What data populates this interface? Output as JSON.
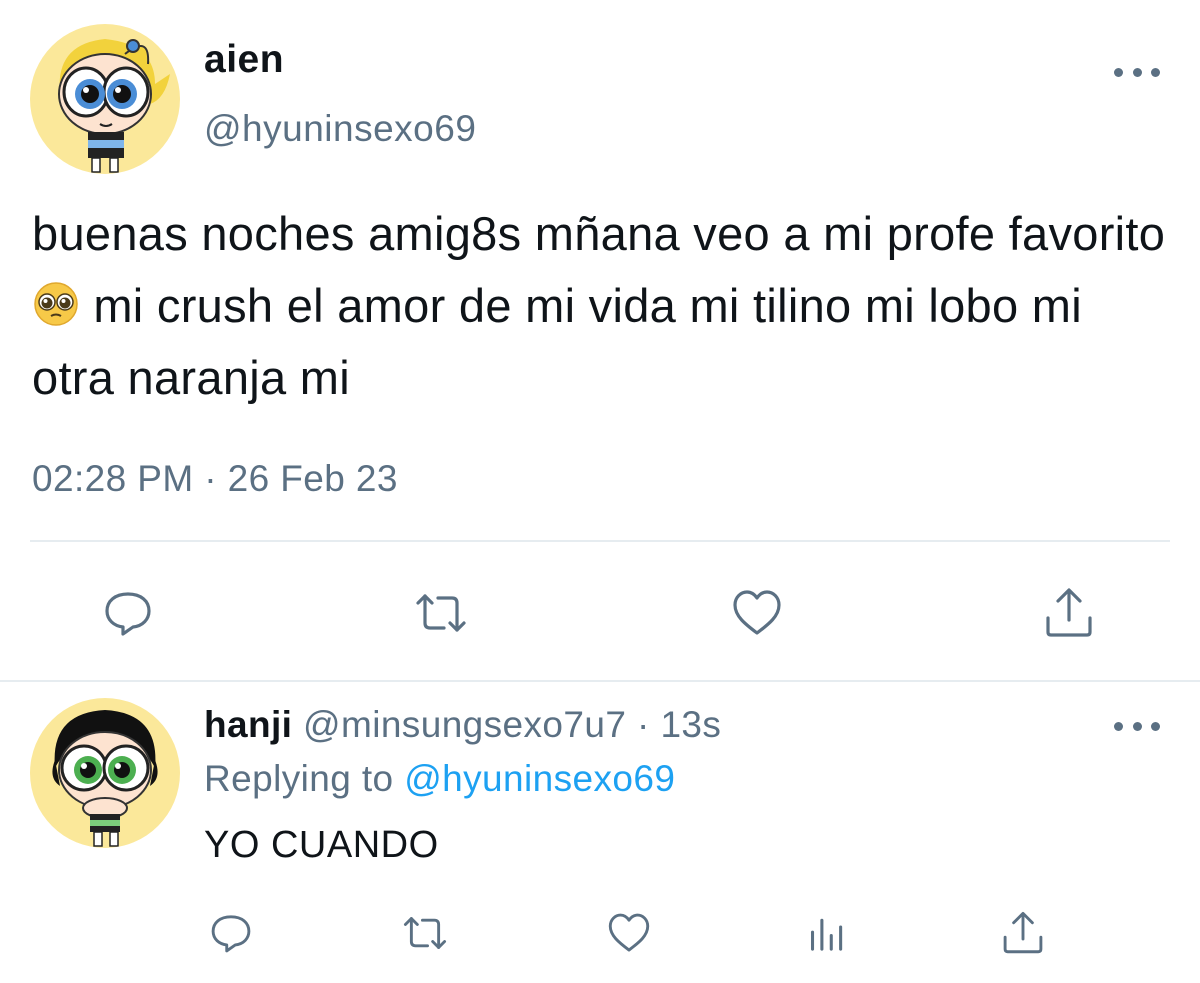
{
  "tweet": {
    "author_name": "aien",
    "author_handle": "@hyuninsexo69",
    "text_before_emoji": "buenas noches amig8s mñana veo a mi profe favorito",
    "emoji": "pleading-face-emoji",
    "text_after_emoji": " mi crush el amor de mi vida mi tilino mi lobo mi otra naranja mi",
    "timestamp": "02:28 PM · 26 Feb 23",
    "avatar": "bubbles-avatar",
    "actions": [
      "reply-icon",
      "retweet-icon",
      "like-icon",
      "share-icon"
    ]
  },
  "reply": {
    "author_name": "hanji",
    "author_handle": "@minsungsexo7u7",
    "separator": "·",
    "time_ago": "13s",
    "replying_label": "Replying to",
    "replying_handle": "@hyuninsexo69",
    "text": "YO CUANDO",
    "avatar": "buttercup-avatar",
    "actions": [
      "reply-icon",
      "retweet-icon",
      "like-icon",
      "analytics-icon",
      "share-icon"
    ]
  },
  "colors": {
    "secondary_text": "#5b7083",
    "link": "#1da1f2",
    "divider": "#e6ecf0",
    "avatar_bg": "#fbe89a"
  }
}
